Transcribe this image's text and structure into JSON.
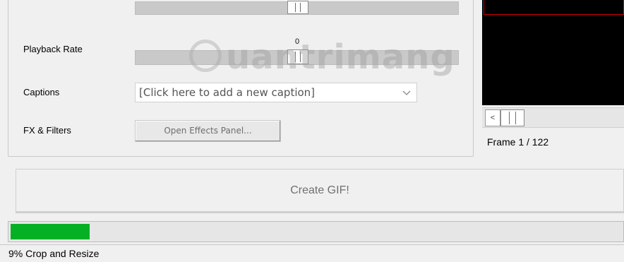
{
  "settings": {
    "playback_rate": {
      "label": "Playback Rate",
      "value": "0"
    },
    "captions": {
      "label": "Captions",
      "placeholder": "[Click here to add a new caption]"
    },
    "fx_filters": {
      "label": "FX & Filters",
      "button_label": "Open Effects Panel..."
    }
  },
  "preview": {
    "frame_label": "Frame",
    "frame_current": "1",
    "frame_total": "122",
    "frame_text": "Frame  1 / 122",
    "scroll_left_glyph": "<"
  },
  "create_button": {
    "label": "Create GIF!"
  },
  "progress": {
    "fraction": 0.13,
    "color": "#06b025"
  },
  "status": {
    "text": "9% Crop and Resize"
  },
  "watermark": {
    "text": "uantrimang"
  },
  "colors": {
    "preview_background": "#000000",
    "preview_highlight": "#d00000"
  }
}
